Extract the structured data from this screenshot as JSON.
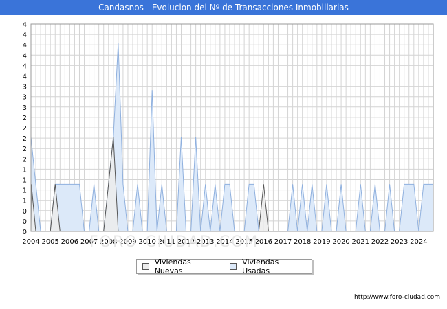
{
  "source": "http://www.foro-ciudad.com",
  "watermark": "FORO-CIUDAD.COM",
  "legend": [
    {
      "label": "Viviendas Nuevas",
      "color": "#ececec"
    },
    {
      "label": "Viviendas Usadas",
      "color": "#dce9f9"
    }
  ],
  "chart_data": {
    "type": "area",
    "title": "Candasnos - Evolucion del Nº de Transacciones Inmobiliarias",
    "xlabel": "",
    "ylabel": "",
    "x_tick_labels": [
      "2004",
      "2005",
      "2006",
      "2007",
      "2008",
      "2009",
      "2010",
      "2011",
      "2012",
      "2013",
      "2014",
      "2015",
      "2016",
      "2017",
      "2018",
      "2019",
      "2020",
      "2021",
      "2022",
      "2023",
      "2024"
    ],
    "y_tick_labels": [
      "0",
      "0",
      "0",
      "1",
      "1",
      "1",
      "1",
      "2",
      "2",
      "2",
      "2",
      "2",
      "3",
      "3",
      "3",
      "4",
      "4",
      "4",
      "4",
      "4"
    ],
    "ylim": [
      0,
      4.4
    ],
    "xlim": [
      2004,
      2024.75
    ],
    "grid": true,
    "legend_position": "bottom",
    "series": [
      {
        "name": "Viviendas Nuevas",
        "color": "#555555",
        "fill": "#ececec",
        "points": [
          [
            2004,
            0
          ],
          [
            2004.02,
            1
          ],
          [
            2004.25,
            0
          ],
          [
            2005.0,
            0
          ],
          [
            2005.25,
            1
          ],
          [
            2005.5,
            0
          ],
          [
            2007.75,
            0
          ],
          [
            2008.25,
            2
          ],
          [
            2008.5,
            0
          ],
          [
            2015.75,
            0
          ],
          [
            2016.0,
            1
          ],
          [
            2016.25,
            0
          ],
          [
            2024.75,
            0
          ]
        ]
      },
      {
        "name": "Viviendas Usadas",
        "color": "#8fb0de",
        "fill": "#dce9f9",
        "points": [
          [
            2004,
            2
          ],
          [
            2004.25,
            1
          ],
          [
            2004.5,
            0
          ],
          [
            2005.0,
            0
          ],
          [
            2005.25,
            1
          ],
          [
            2006.5,
            1
          ],
          [
            2006.75,
            0
          ],
          [
            2007.0,
            0
          ],
          [
            2007.25,
            1
          ],
          [
            2007.5,
            0
          ],
          [
            2007.75,
            0
          ],
          [
            2008.25,
            2
          ],
          [
            2008.5,
            4
          ],
          [
            2008.75,
            1
          ],
          [
            2009.0,
            0
          ],
          [
            2009.25,
            0
          ],
          [
            2009.5,
            1
          ],
          [
            2009.75,
            0
          ],
          [
            2010.0,
            0
          ],
          [
            2010.25,
            3
          ],
          [
            2010.5,
            0
          ],
          [
            2010.75,
            1
          ],
          [
            2011.0,
            0
          ],
          [
            2011.5,
            0
          ],
          [
            2011.75,
            2
          ],
          [
            2012.0,
            0
          ],
          [
            2012.25,
            0
          ],
          [
            2012.5,
            2
          ],
          [
            2012.75,
            0
          ],
          [
            2013.0,
            1
          ],
          [
            2013.25,
            0
          ],
          [
            2013.5,
            1
          ],
          [
            2013.75,
            0
          ],
          [
            2014.0,
            1
          ],
          [
            2014.25,
            1
          ],
          [
            2014.5,
            0
          ],
          [
            2015.0,
            0
          ],
          [
            2015.25,
            1
          ],
          [
            2015.5,
            1
          ],
          [
            2015.75,
            0
          ],
          [
            2017.25,
            0
          ],
          [
            2017.5,
            1
          ],
          [
            2017.75,
            0
          ],
          [
            2018.0,
            1
          ],
          [
            2018.25,
            0
          ],
          [
            2018.5,
            1
          ],
          [
            2018.75,
            0
          ],
          [
            2019.0,
            0
          ],
          [
            2019.25,
            1
          ],
          [
            2019.5,
            0
          ],
          [
            2019.75,
            0
          ],
          [
            2020.0,
            1
          ],
          [
            2020.25,
            0
          ],
          [
            2020.75,
            0
          ],
          [
            2021.0,
            1
          ],
          [
            2021.25,
            0
          ],
          [
            2021.5,
            0
          ],
          [
            2021.75,
            1
          ],
          [
            2022.0,
            0
          ],
          [
            2022.25,
            0
          ],
          [
            2022.5,
            1
          ],
          [
            2022.75,
            0
          ],
          [
            2023.0,
            0
          ],
          [
            2023.25,
            1
          ],
          [
            2023.75,
            1
          ],
          [
            2024.0,
            0
          ],
          [
            2024.25,
            1
          ],
          [
            2024.75,
            1
          ]
        ]
      }
    ]
  }
}
